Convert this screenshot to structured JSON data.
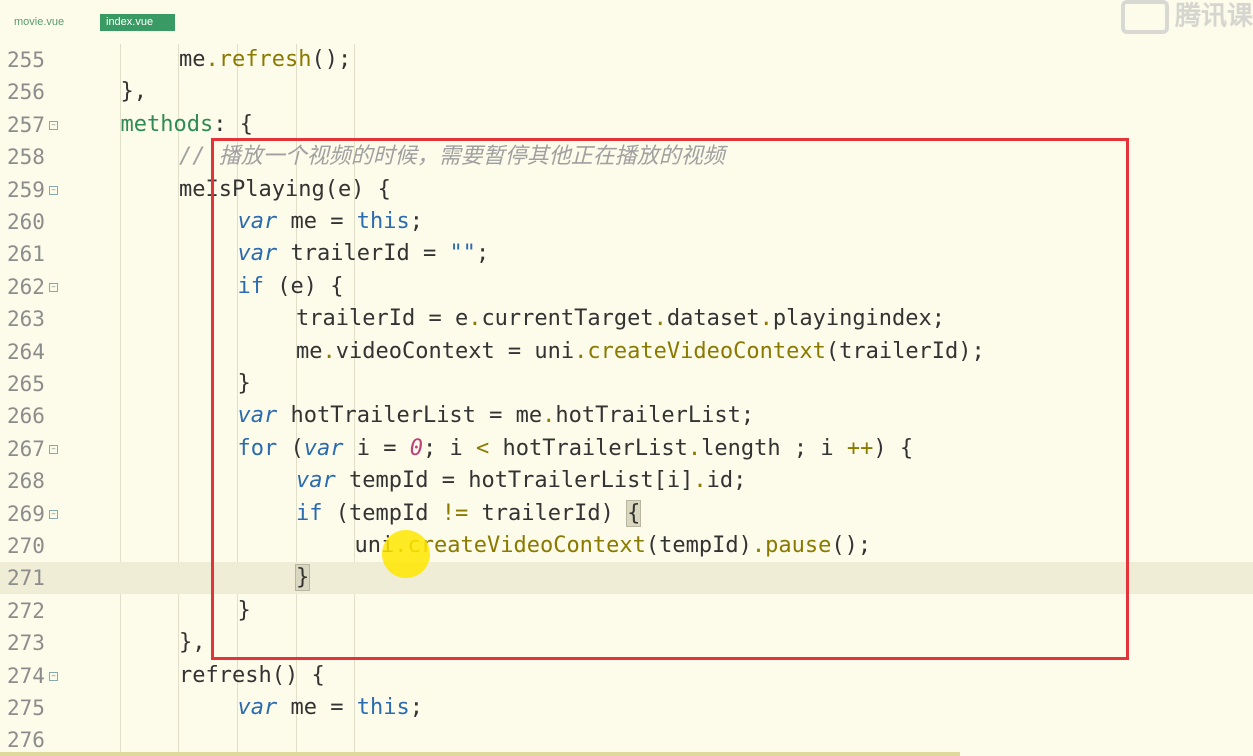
{
  "tabs": [
    "movie.vue",
    "index.vue"
  ],
  "watermark": "腾讯课",
  "lines": [
    {
      "n": "255",
      "fold": false,
      "indent": 3,
      "tokens": [
        [
          "me",
          ""
        ],
        [
          ".",
          "op"
        ],
        [
          "refresh",
          "fn"
        ],
        [
          "();",
          ""
        ]
      ]
    },
    {
      "n": "256",
      "fold": false,
      "indent": 2,
      "tokens": [
        [
          "},",
          ""
        ]
      ]
    },
    {
      "n": "257",
      "fold": true,
      "indent": 2,
      "tokens": [
        [
          "methods",
          "prop"
        ],
        [
          ": {",
          ""
        ]
      ]
    },
    {
      "n": "258",
      "fold": false,
      "indent": 3,
      "tokens": [
        [
          "// 播放一个视频的时候，需要暂停其他正在播放的视频",
          "cm"
        ]
      ]
    },
    {
      "n": "259",
      "fold": true,
      "indent": 3,
      "tokens": [
        [
          "meIsPlaying(e) {",
          ""
        ]
      ]
    },
    {
      "n": "260",
      "fold": false,
      "indent": 4,
      "tokens": [
        [
          "var",
          "kw"
        ],
        [
          " me = ",
          ""
        ],
        [
          "this",
          "kwu"
        ],
        [
          ";",
          ""
        ]
      ]
    },
    {
      "n": "261",
      "fold": false,
      "indent": 4,
      "tokens": [
        [
          "var",
          "kw"
        ],
        [
          " trailerId = ",
          ""
        ],
        [
          "\"\"",
          "str"
        ],
        [
          ";",
          ""
        ]
      ]
    },
    {
      "n": "262",
      "fold": true,
      "indent": 4,
      "tokens": [
        [
          "if",
          "kwu"
        ],
        [
          " (e) {",
          ""
        ]
      ]
    },
    {
      "n": "263",
      "fold": false,
      "indent": 5,
      "tokens": [
        [
          "trailerId = e",
          ""
        ],
        [
          ".",
          "op"
        ],
        [
          "currentTarget",
          ""
        ],
        [
          ".",
          "op"
        ],
        [
          "dataset",
          ""
        ],
        [
          ".",
          "op"
        ],
        [
          "playingindex;",
          ""
        ]
      ]
    },
    {
      "n": "264",
      "fold": false,
      "indent": 5,
      "tokens": [
        [
          "me",
          ""
        ],
        [
          ".",
          "op"
        ],
        [
          "videoContext = uni",
          ""
        ],
        [
          ".",
          "op"
        ],
        [
          "createVideoContext",
          "fn"
        ],
        [
          "(trailerId);",
          ""
        ]
      ]
    },
    {
      "n": "265",
      "fold": false,
      "indent": 4,
      "tokens": [
        [
          "}",
          ""
        ]
      ]
    },
    {
      "n": "266",
      "fold": false,
      "indent": 4,
      "tokens": [
        [
          "var",
          "kw"
        ],
        [
          " hotTrailerList = me",
          ""
        ],
        [
          ".",
          "op"
        ],
        [
          "hotTrailerList;",
          ""
        ]
      ]
    },
    {
      "n": "267",
      "fold": true,
      "indent": 4,
      "tokens": [
        [
          "for",
          "kwu"
        ],
        [
          " (",
          ""
        ],
        [
          "var",
          "kw"
        ],
        [
          " i = ",
          ""
        ],
        [
          "0",
          "num"
        ],
        [
          "; i ",
          ""
        ],
        [
          "<",
          "op"
        ],
        [
          " hotTrailerList",
          ""
        ],
        [
          ".",
          "op"
        ],
        [
          "length ; i ",
          ""
        ],
        [
          "++",
          "op"
        ],
        [
          ") {",
          ""
        ]
      ]
    },
    {
      "n": "268",
      "fold": false,
      "indent": 5,
      "tokens": [
        [
          "var",
          "kw"
        ],
        [
          " tempId = hotTrailerList[i]",
          ""
        ],
        [
          ".",
          "op"
        ],
        [
          "id;",
          ""
        ]
      ]
    },
    {
      "n": "269",
      "fold": true,
      "indent": 5,
      "tokens": [
        [
          "if",
          "kwu"
        ],
        [
          " (tempId ",
          ""
        ],
        [
          "!=",
          "op"
        ],
        [
          " trailerId) ",
          ""
        ],
        [
          "{",
          "bracket-hl"
        ]
      ]
    },
    {
      "n": "270",
      "fold": false,
      "indent": 6,
      "tokens": [
        [
          "uni",
          ""
        ],
        [
          ".",
          "op"
        ],
        [
          "createVideoContext",
          "fn"
        ],
        [
          "(tempId)",
          ""
        ],
        [
          ".",
          "op"
        ],
        [
          "pause",
          "fn"
        ],
        [
          "();",
          ""
        ]
      ]
    },
    {
      "n": "271",
      "fold": false,
      "indent": 5,
      "tokens": [
        [
          "}",
          "bracket-hl"
        ]
      ]
    },
    {
      "n": "272",
      "fold": false,
      "indent": 4,
      "tokens": [
        [
          "}",
          ""
        ]
      ]
    },
    {
      "n": "273",
      "fold": false,
      "indent": 3,
      "tokens": [
        [
          "},",
          ""
        ]
      ]
    },
    {
      "n": "274",
      "fold": true,
      "indent": 3,
      "tokens": [
        [
          "refresh() {",
          ""
        ]
      ]
    },
    {
      "n": "275",
      "fold": false,
      "indent": 4,
      "tokens": [
        [
          "var",
          "kw"
        ],
        [
          " me = ",
          ""
        ],
        [
          "this",
          "kwu"
        ],
        [
          ";",
          ""
        ]
      ]
    },
    {
      "n": "276",
      "fold": false,
      "indent": 3,
      "tokens": []
    }
  ],
  "current_line": "271"
}
